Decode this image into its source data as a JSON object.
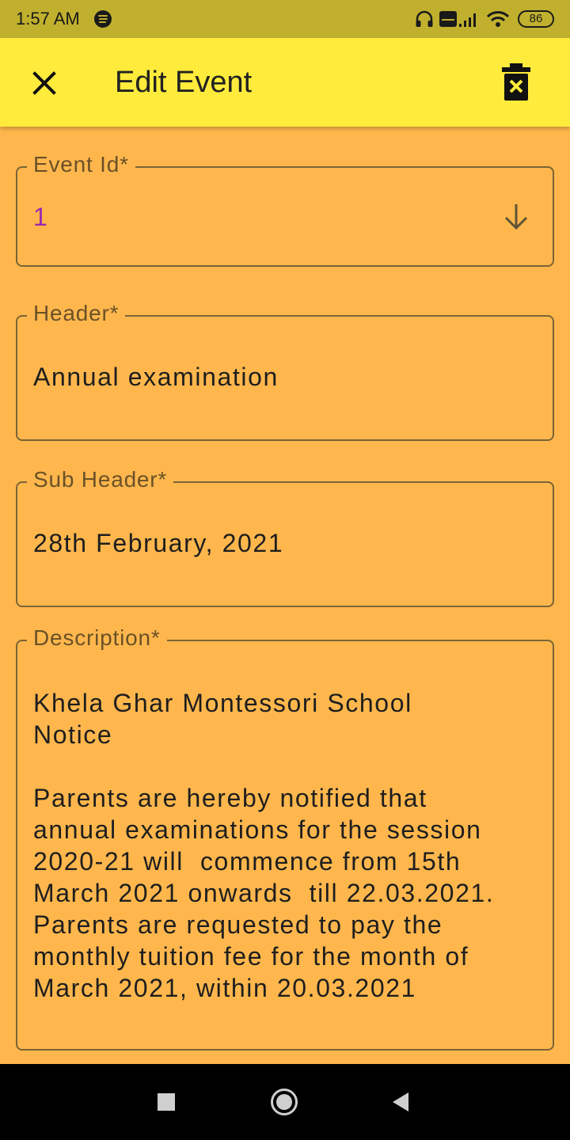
{
  "status_bar": {
    "time": "1:57 AM",
    "battery_level": "86",
    "icons": [
      "spotify-icon",
      "headphones-icon",
      "volte-icon",
      "signal-icon",
      "wifi-icon",
      "battery-icon"
    ]
  },
  "app_bar": {
    "title": "Edit Event",
    "close_icon": "close-icon",
    "delete_icon": "delete-icon"
  },
  "form": {
    "event_id": {
      "label": "Event Id*",
      "value": "1"
    },
    "header": {
      "label": "Header*",
      "value": "Annual examination"
    },
    "sub_header": {
      "label": "Sub Header*",
      "value": "28th February, 2021"
    },
    "description": {
      "label": "Description*",
      "value": "Khela Ghar Montessori School\nNotice\n\nParents are hereby notified that\nannual examinations for the session\n2020-21 will  commence from 15th\nMarch 2021 onwards  till 22.03.2021.\nParents are requested to pay the\nmonthly tuition fee for the month of\nMarch 2021, within 20.03.2021"
    }
  },
  "nav_bar": {
    "buttons": [
      "recents-button",
      "home-button",
      "back-button"
    ]
  },
  "colors": {
    "background": "#ffb74d",
    "app_bar": "#ffeb3b",
    "status_bar": "#c0b02e",
    "accent": "#9c27b0"
  }
}
